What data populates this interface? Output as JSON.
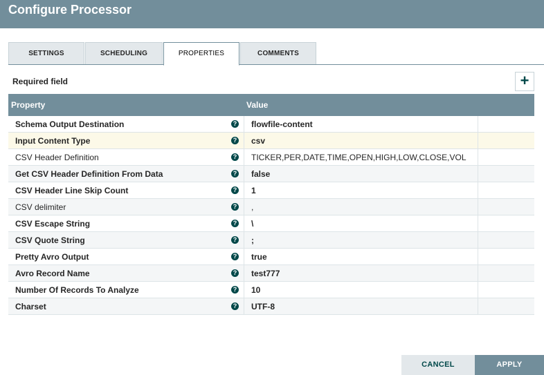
{
  "dialog": {
    "title": "Configure Processor"
  },
  "tabs": [
    {
      "label": "SETTINGS"
    },
    {
      "label": "SCHEDULING"
    },
    {
      "label": "PROPERTIES"
    },
    {
      "label": "COMMENTS"
    }
  ],
  "active_tab": "PROPERTIES",
  "required_label": "Required field",
  "add_button": {
    "icon": "plus-icon",
    "glyph": "+"
  },
  "table": {
    "headers": {
      "property": "Property",
      "value": "Value"
    },
    "rows": [
      {
        "name": "Schema Output Destination",
        "value": "flowfile-content",
        "bold": true,
        "value_bold": true
      },
      {
        "name": "Input Content Type",
        "value": "csv",
        "bold": true,
        "value_bold": true,
        "highlight": true
      },
      {
        "name": "CSV Header Definition",
        "value": "TICKER,PER,DATE,TIME,OPEN,HIGH,LOW,CLOSE,VOL",
        "bold": false,
        "value_bold": false
      },
      {
        "name": "Get CSV Header Definition From Data",
        "value": "false",
        "bold": true,
        "value_bold": true
      },
      {
        "name": "CSV Header Line Skip Count",
        "value": "1",
        "bold": true,
        "value_bold": true
      },
      {
        "name": "CSV delimiter",
        "value": ",",
        "bold": false,
        "value_bold": false
      },
      {
        "name": "CSV Escape String",
        "value": "\\",
        "bold": true,
        "value_bold": true
      },
      {
        "name": "CSV Quote String",
        "value": ";",
        "bold": true,
        "value_bold": true
      },
      {
        "name": "Pretty Avro Output",
        "value": "true",
        "bold": true,
        "value_bold": true
      },
      {
        "name": "Avro Record Name",
        "value": "test777",
        "bold": true,
        "value_bold": true
      },
      {
        "name": "Number Of Records To Analyze",
        "value": "10",
        "bold": true,
        "value_bold": true
      },
      {
        "name": "Charset",
        "value": "UTF-8",
        "bold": true,
        "value_bold": true
      }
    ],
    "help_icon": {
      "icon": "question-circle-icon",
      "glyph": "?"
    }
  },
  "footer": {
    "cancel_label": "CANCEL",
    "apply_label": "APPLY"
  },
  "colors": {
    "header": "#728e9b",
    "accent": "#004849",
    "highlight_row": "#fcf9e8",
    "tab_inactive": "#e3e8eb"
  }
}
